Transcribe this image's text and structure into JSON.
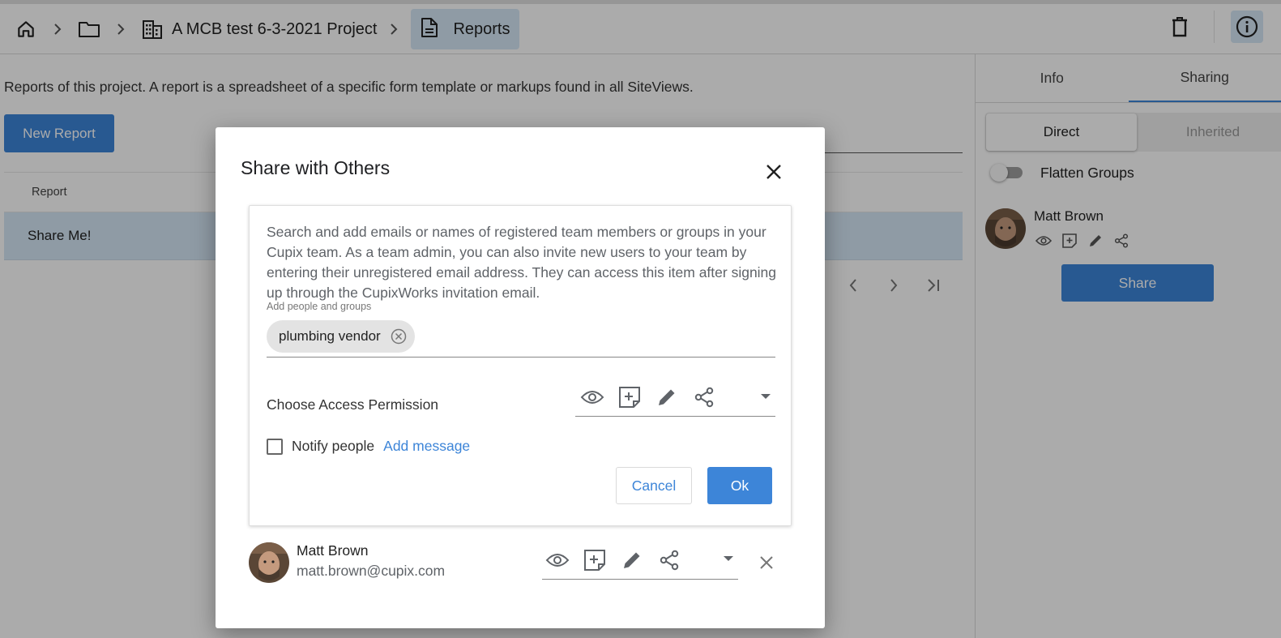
{
  "breadcrumb": {
    "items": [
      {
        "icon": "home-icon"
      },
      {
        "icon": "folder-icon"
      },
      {
        "icon": "building-icon",
        "label": "A MCB test 6-3-2021 Project"
      },
      {
        "icon": "document-icon",
        "label": "Reports"
      }
    ]
  },
  "toolbar": {
    "icons": [
      "trash-icon",
      "info-icon"
    ]
  },
  "main": {
    "description": "Reports of this project. A report is a spreadsheet of a specific form template or markups found in all SiteViews.",
    "new_report_label": "New Report",
    "table": {
      "columns": [
        "Report"
      ],
      "rows": [
        {
          "name": "Share Me!"
        }
      ]
    }
  },
  "right_panel": {
    "tabs": [
      "Info",
      "Sharing"
    ],
    "active_tab": "Sharing",
    "segments": [
      "Direct",
      "Inherited"
    ],
    "active_segment": "Direct",
    "flatten_groups_label": "Flatten Groups",
    "flatten_groups_on": false,
    "user": {
      "name": "Matt Brown"
    },
    "share_label": "Share"
  },
  "dialog": {
    "title": "Share with Others",
    "help_text": "Search and add emails or names of registered team members or groups in your Cupix team. As a team admin, you can also invite new users to your team by entering their unregistered email address. They can access this item after signing up through the CupixWorks invitation email.",
    "field_label": "Add people and groups",
    "chips": [
      "plumbing vendor"
    ],
    "permission_label": "Choose Access Permission",
    "notify_label": "Notify people",
    "notify_checked": false,
    "add_message_label": "Add message",
    "cancel_label": "Cancel",
    "ok_label": "Ok",
    "member": {
      "name": "Matt Brown",
      "email": "matt.brown@cupix.com"
    }
  },
  "colors": {
    "accent": "#3d85d8",
    "selected_bg": "#d5e7f6",
    "overlay": "rgba(0,0,0,0.33)"
  }
}
